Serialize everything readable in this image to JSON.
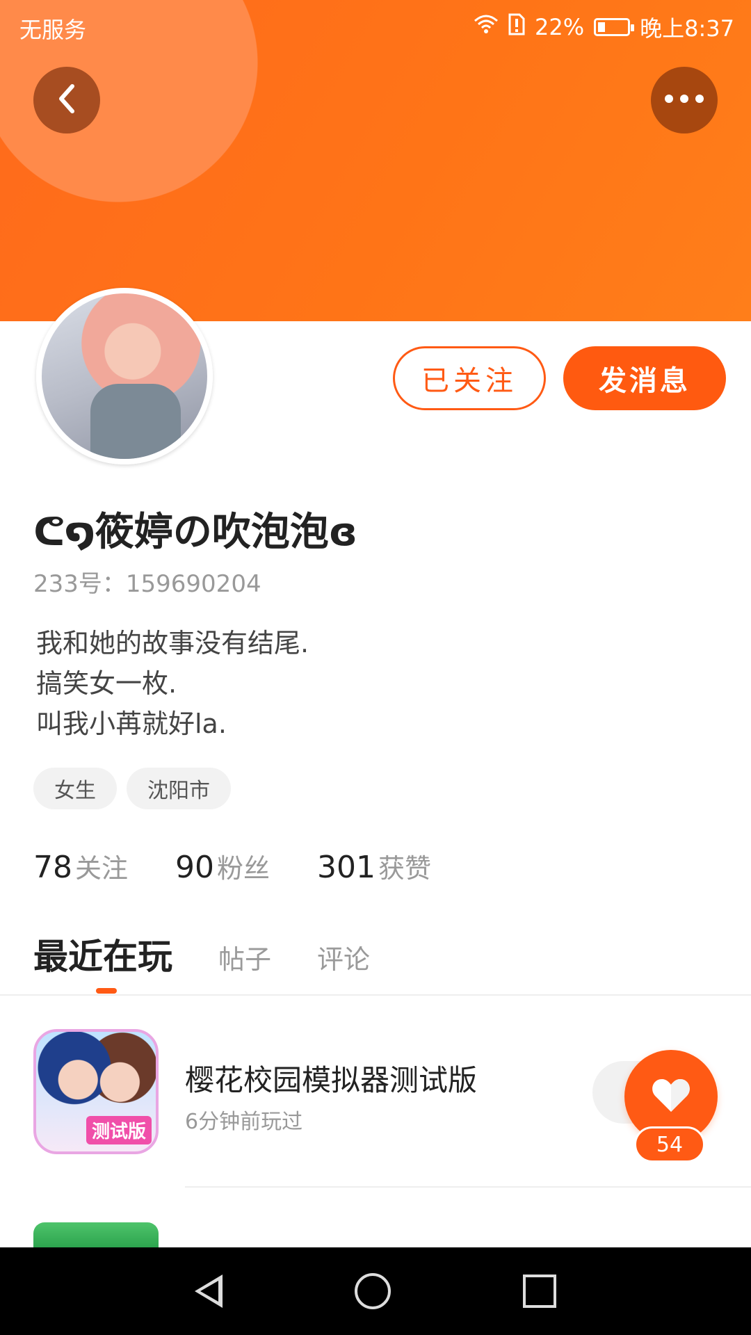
{
  "status_bar": {
    "carrier": "无服务",
    "battery": "22%",
    "time": "晚上8:37",
    "icons": [
      "wifi-icon",
      "sim-alert-icon",
      "battery-icon"
    ]
  },
  "header": {
    "back_icon": "chevron-left-icon",
    "more_icon": "more-horizontal-icon",
    "accent": "#ff5a14"
  },
  "profile": {
    "nickname": "ᕦ໑筱婷の吹泡泡ɞ",
    "id_line": "233号：159690204",
    "bio": [
      "我和她的故事没有结尾.",
      "搞笑女一枚.",
      "叫我小苒就好la."
    ],
    "tags": [
      "女生",
      "沈阳市"
    ],
    "follow_button": "已关注",
    "message_button": "发消息",
    "stats": [
      {
        "value": "78",
        "label": "关注"
      },
      {
        "value": "90",
        "label": "粉丝"
      },
      {
        "value": "301",
        "label": "获赞"
      }
    ]
  },
  "tabs": [
    {
      "label": "最近在玩",
      "active": true
    },
    {
      "label": "帖子",
      "active": false
    },
    {
      "label": "评论",
      "active": false
    }
  ],
  "games": [
    {
      "title": "樱花校园模拟器测试版",
      "subtitle": "6分钟前玩过",
      "badge": "测试版",
      "likes": "54"
    }
  ],
  "navbar": {
    "icons": [
      "nav-back-icon",
      "nav-home-icon",
      "nav-recent-icon"
    ]
  }
}
